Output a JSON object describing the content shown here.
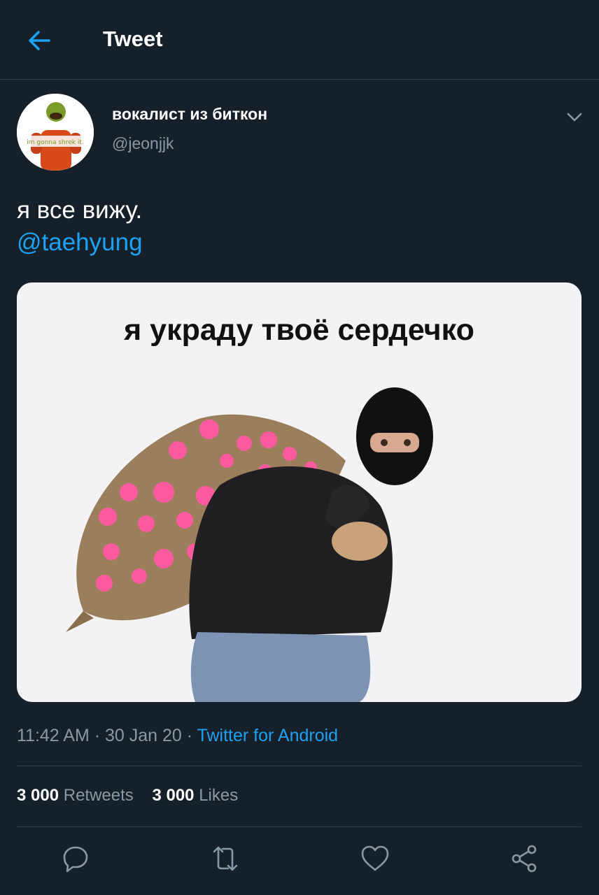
{
  "header": {
    "title": "Tweet"
  },
  "author": {
    "display_name": "вокалист из биткон",
    "handle": "@jeonjjk",
    "avatar_caption": "im gonna shrek it."
  },
  "tweet": {
    "text": "я все вижу.",
    "mention": "@taehyung"
  },
  "media": {
    "caption": "я украду твоё сердечко"
  },
  "meta": {
    "time": "11:42 AM",
    "sep1": " · ",
    "date": "30 Jan 20",
    "sep2": " · ",
    "source": "Twitter for Android"
  },
  "stats": {
    "retweets_count": "3 000",
    "retweets_label": "Retweets",
    "likes_count": "3 000",
    "likes_label": "Likes"
  },
  "colors": {
    "background": "#15202b",
    "accent": "#1da1f2",
    "muted": "#8899a6",
    "divider": "#2f3f4f"
  },
  "icons": [
    "back-arrow-icon",
    "chevron-down-icon",
    "reply-icon",
    "retweet-icon",
    "like-icon",
    "share-icon"
  ]
}
